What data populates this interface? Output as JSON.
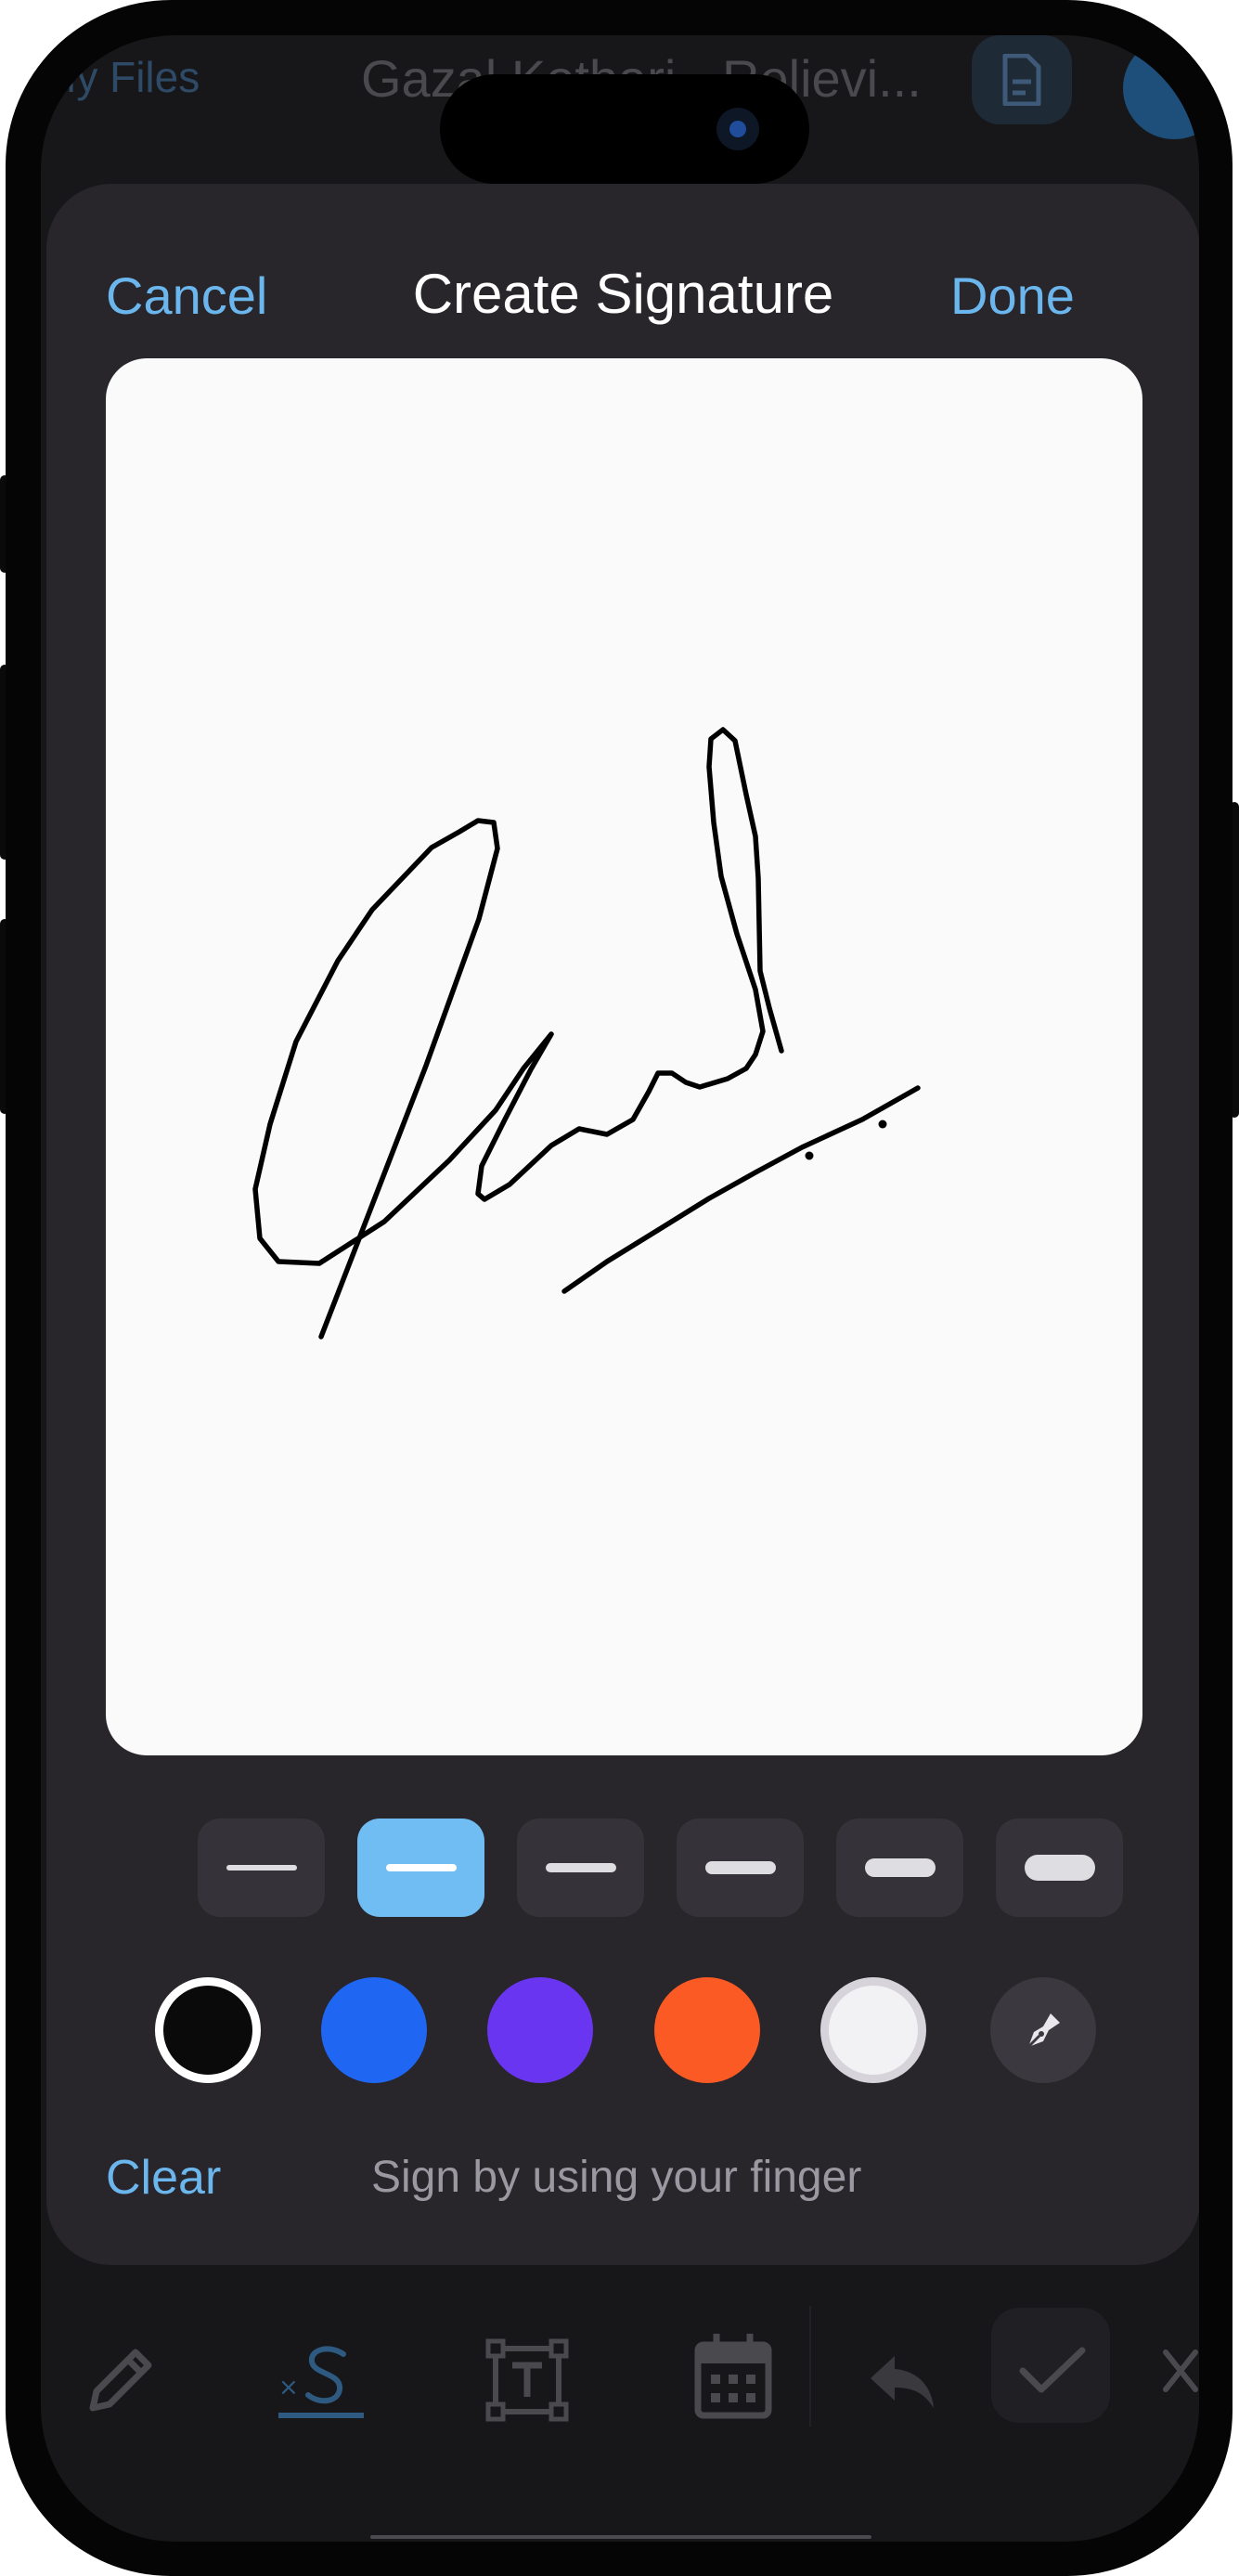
{
  "background_app": {
    "back_label": "My Files",
    "document_title": "Gazal Kothari - Relievi..."
  },
  "signature_sheet": {
    "cancel_label": "Cancel",
    "title": "Create Signature",
    "done_label": "Done",
    "stroke_widths": [
      {
        "name": "thinnest",
        "selected": false
      },
      {
        "name": "thin",
        "selected": true
      },
      {
        "name": "regular",
        "selected": false
      },
      {
        "name": "medium",
        "selected": false
      },
      {
        "name": "thick",
        "selected": false
      },
      {
        "name": "thickest",
        "selected": false
      }
    ],
    "colors": [
      {
        "name": "black",
        "hex": "#0a0a0a",
        "selected": true
      },
      {
        "name": "blue",
        "hex": "#1f67f2",
        "selected": false
      },
      {
        "name": "purple",
        "hex": "#6a35f0",
        "selected": false
      },
      {
        "name": "orange",
        "hex": "#fb5a24",
        "selected": false
      },
      {
        "name": "white",
        "hex": "#f2f2f4",
        "selected": false
      }
    ],
    "pen_icon": "pen-nib-icon",
    "clear_label": "Clear",
    "hint": "Sign by using your finger"
  },
  "toolbar": {
    "tools": [
      "pencil-icon",
      "signature-icon",
      "text-box-icon",
      "calendar-icon",
      "undo-icon",
      "checkmark-icon",
      "close-icon"
    ],
    "active_tool": "signature-icon"
  },
  "colors": {
    "accent": "#6cb6ee",
    "sheet_background": "#28262b",
    "selected_stroke": "#6fbdf2"
  }
}
